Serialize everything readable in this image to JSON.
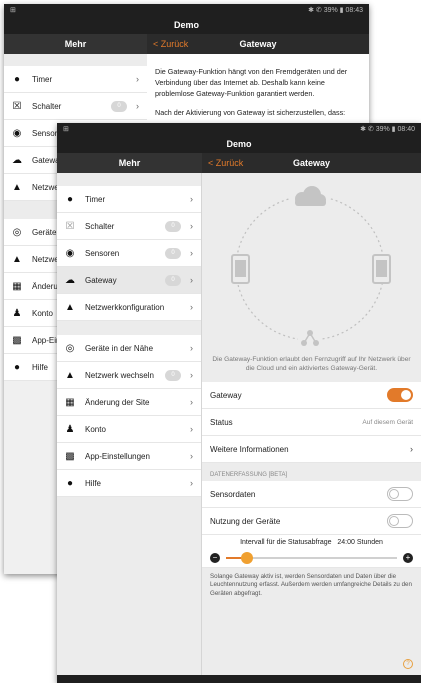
{
  "back_tab": {
    "status_right": "✱ ✆ 39% ▮ 08:43",
    "title": "Demo",
    "left_header": "Mehr",
    "right_header": "Gateway",
    "back_label": "< Zurück",
    "menu": [
      {
        "label": "Timer",
        "icon": "clock-icon",
        "chev": "›"
      },
      {
        "label": "Schalter",
        "icon": "switch-icon",
        "count": "0",
        "chev": "›"
      },
      {
        "label": "Sensoren",
        "icon": "sensor-icon"
      },
      {
        "label": "Gateway",
        "icon": "cloud-icon"
      },
      {
        "label": "Netzwerkkonfiguration",
        "icon": "network-icon"
      },
      {
        "label": "Geräte in der Nähe",
        "icon": "nearby-icon"
      },
      {
        "label": "Netzwerk wechseln",
        "icon": "network-icon"
      },
      {
        "label": "Änderung der Site",
        "icon": "building-icon"
      },
      {
        "label": "Konto",
        "icon": "user-icon"
      },
      {
        "label": "App-Einstellungen",
        "icon": "settings-icon"
      },
      {
        "label": "Hilfe",
        "icon": "info-icon"
      }
    ],
    "para1": "Die Gateway-Funktion hängt von den Fremdgeräten und der Verbindung über das Internet ab. Deshalb kann keine problemlose Gateway-Funktion garantiert werden.",
    "para2": "Nach der Aktivierung von Gateway ist sicherzustellen, dass:"
  },
  "front_tab": {
    "status_right": "✱ ✆ 39% ▮ 08:40",
    "title": "Demo",
    "left_header": "Mehr",
    "right_header": "Gateway",
    "back_label": "< Zurück",
    "menu_group1": [
      {
        "label": "Timer",
        "icon": "clock-icon",
        "chev": "›"
      },
      {
        "label": "Schalter",
        "icon": "switch-icon",
        "count": "0",
        "chev": "›"
      },
      {
        "label": "Sensoren",
        "icon": "sensor-icon",
        "count": "0",
        "chev": "›"
      },
      {
        "label": "Gateway",
        "icon": "cloud-icon",
        "count": "0",
        "chev": "›"
      },
      {
        "label": "Netzwerkkonfiguration",
        "icon": "network-icon",
        "chev": "›"
      }
    ],
    "menu_group2": [
      {
        "label": "Geräte in der Nähe",
        "icon": "nearby-icon",
        "chev": "›"
      },
      {
        "label": "Netzwerk wechseln",
        "icon": "network-icon",
        "count": "0",
        "chev": "›"
      },
      {
        "label": "Änderung der Site",
        "icon": "building-icon",
        "chev": "›"
      },
      {
        "label": "Konto",
        "icon": "user-icon",
        "chev": "›"
      },
      {
        "label": "App-Einstellungen",
        "icon": "settings-icon",
        "chev": "›"
      },
      {
        "label": "Hilfe",
        "icon": "info-icon",
        "chev": "›"
      }
    ],
    "description": "Die Gateway-Funktion erlaubt den Fernzugriff auf Ihr Netzwerk über die Cloud und ein aktiviertes Gateway-Gerät.",
    "gateway_label": "Gateway",
    "gateway_on": true,
    "status_label": "Status",
    "status_value": "Auf diesem Gerät",
    "more_info_label": "Weitere Informationen",
    "more_info_chev": "›",
    "section_label": "DATENERFASSUNG [BETA]",
    "sensor_data_label": "Sensordaten",
    "usage_label": "Nutzung der Geräte",
    "interval_label": "Intervall für die Statusabfrage",
    "interval_value": "24:00 Stunden",
    "slider_level": 0.12,
    "footer_note": "Solange Gateway aktiv ist, werden Sensordaten und Daten über die Leuchtennutzung erfasst. Außerdem werden umfangreiche Details zu den Geräten abgefragt."
  },
  "colors": {
    "accent": "#e27a2a",
    "bar": "#1f1f1f"
  }
}
